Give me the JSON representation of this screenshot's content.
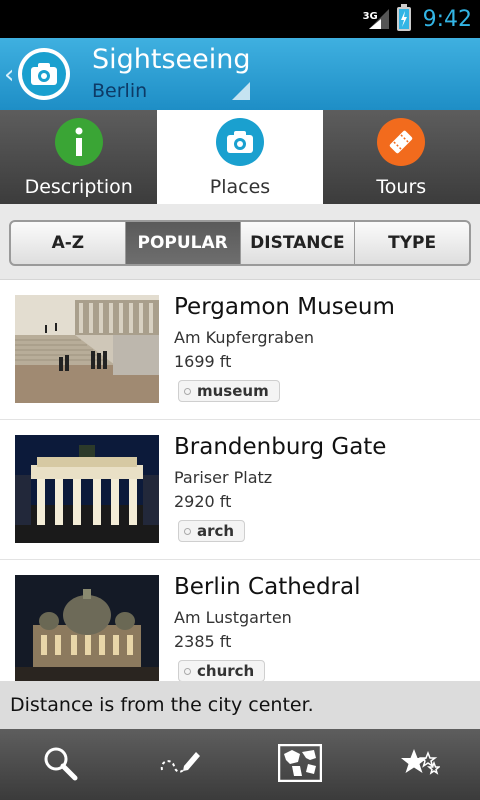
{
  "status_bar": {
    "network": "3G",
    "time": "9:42"
  },
  "action_bar": {
    "title": "Sightseeing",
    "subtitle": "Berlin",
    "logo_icon": "camera-icon"
  },
  "tabs": [
    {
      "label": "Description",
      "icon": "info-icon",
      "color": "#3aa535",
      "active": false
    },
    {
      "label": "Places",
      "icon": "camera-icon",
      "color": "#1aa0cf",
      "active": true
    },
    {
      "label": "Tours",
      "icon": "ticket-icon",
      "color": "#f26b1d",
      "active": false
    }
  ],
  "sort": {
    "options": [
      "A-Z",
      "POPULAR",
      "DISTANCE",
      "TYPE"
    ],
    "selected": "POPULAR"
  },
  "places": [
    {
      "name": "Pergamon Museum",
      "address": "Am Kupfergraben",
      "distance": "1699 ft",
      "tag": "museum"
    },
    {
      "name": "Brandenburg Gate",
      "address": "Pariser Platz",
      "distance": "2920 ft",
      "tag": "arch"
    },
    {
      "name": "Berlin Cathedral",
      "address": "Am Lustgarten",
      "distance": "2385 ft",
      "tag": "church"
    }
  ],
  "info_text": "Distance is from the city center.",
  "bottom_bar": {
    "icons": [
      "search-icon",
      "draw-route-icon",
      "map-icon",
      "favorites-icon"
    ]
  },
  "colors": {
    "accent": "#33b5e5",
    "action_bar": "#2a9fd6"
  }
}
